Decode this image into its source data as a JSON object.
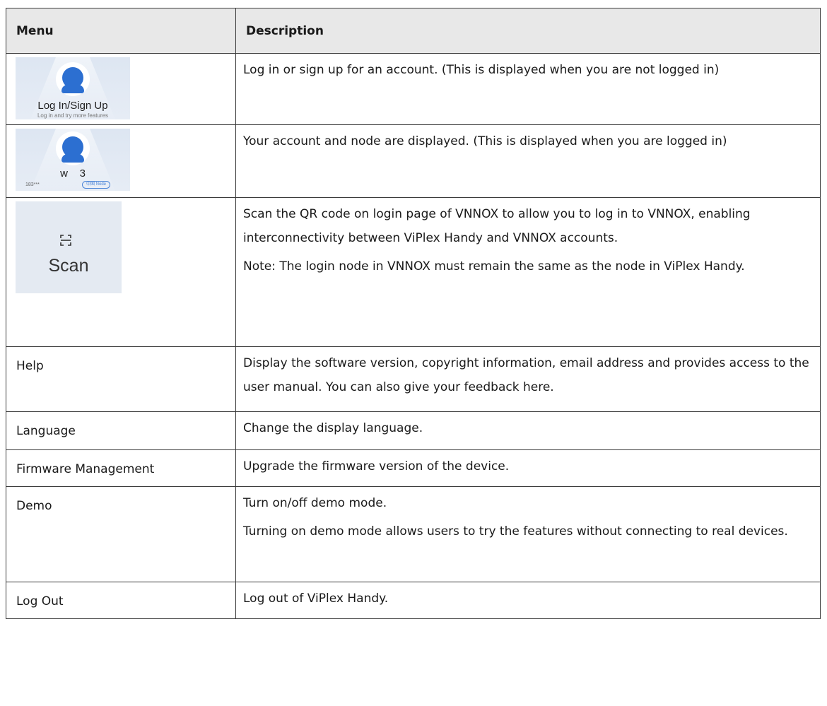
{
  "table": {
    "headers": {
      "menu": "Menu",
      "description": "Description"
    },
    "rows": [
      {
        "menu_image": {
          "kind": "login",
          "title": "Log In/Sign Up",
          "subtitle": "Log in and try more features"
        },
        "description": [
          "Log in or sign up for an account. (This is displayed when you are not logged in)"
        ]
      },
      {
        "menu_image": {
          "kind": "account",
          "username": "w    3",
          "phone": "183***",
          "node_badge": "中国 Node"
        },
        "description": [
          "Your account and node are displayed. (This is displayed when you are logged in)"
        ]
      },
      {
        "menu_image": {
          "kind": "scan",
          "label": "Scan",
          "icon": "scan-icon"
        },
        "description": [
          "Scan the QR code on login page of VNNOX to allow you to log in to VNNOX, enabling interconnectivity between ViPlex Handy and VNNOX accounts.",
          "Note: The login node in VNNOX must remain the same as the node in ViPlex Handy."
        ]
      },
      {
        "menu": "Help",
        "description": [
          "Display the software version, copyright information, email address and provides access to the user manual. You can also give your feedback here."
        ]
      },
      {
        "menu": "Language",
        "description": [
          "Change the display language."
        ]
      },
      {
        "menu": "Firmware Management",
        "description": [
          "Upgrade the firmware version of the device."
        ]
      },
      {
        "menu": "Demo",
        "description": [
          "Turn on/off demo mode.",
          "Turning on demo mode allows users to try the features without connecting to real devices."
        ]
      },
      {
        "menu": "Log Out",
        "description": [
          "Log out of ViPlex Handy."
        ]
      }
    ]
  },
  "colors": {
    "header_bg": "#e8e8e8",
    "border": "#3a3a3a",
    "avatar_blue": "#2c6fd1",
    "thumb_bg": "#e2e9f3"
  }
}
